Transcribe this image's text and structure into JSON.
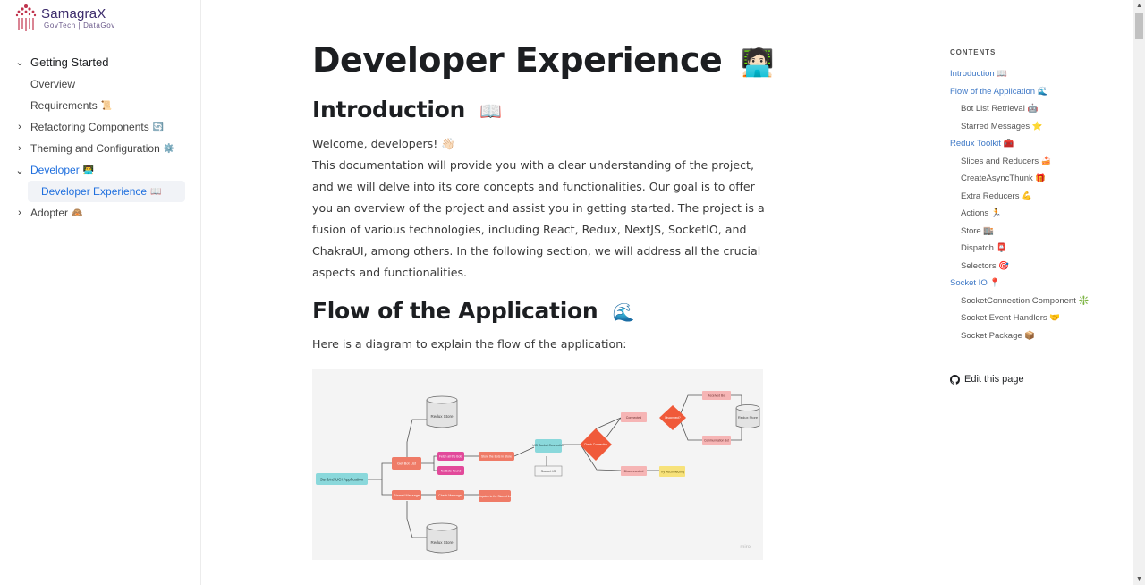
{
  "brand": {
    "name": "SamagraX",
    "tagline": "GovTech | DataGov"
  },
  "sidebar": {
    "items": [
      {
        "label": "Getting Started",
        "chevron": "down"
      },
      {
        "label": "Overview"
      },
      {
        "label": "Requirements",
        "emoji": "📜"
      },
      {
        "label": "Refactoring Components",
        "emoji": "🔄",
        "chevron": "right"
      },
      {
        "label": "Theming and Configuration",
        "emoji": "⚙️",
        "chevron": "right"
      },
      {
        "label": "Developer",
        "emoji": "👨‍💻",
        "chevron": "down"
      },
      {
        "label": "Developer Experience",
        "emoji": "📖"
      },
      {
        "label": "Adopter",
        "emoji": "🙈",
        "chevron": "right"
      }
    ]
  },
  "main": {
    "title": "Developer Experience",
    "title_emoji": "🧑🏻‍💻",
    "intro": {
      "heading": "Introduction",
      "emoji": "📖",
      "welcome": "Welcome, developers! 👋🏻",
      "body": "This documentation will provide you with a clear understanding of the project, and we will delve into its core concepts and functionalities. Our goal is to offer you an overview of the project and assist you in getting started. The project is a fusion of various technologies, including React, Redux, NextJS, SocketIO, and ChakraUI, among others. In the following section, we will address all the crucial aspects and functionalities."
    },
    "flow": {
      "heading": "Flow of the Application",
      "emoji": "🌊",
      "body": "Here is a diagram to explain the flow of the application:"
    },
    "diagram": {
      "nodes": {
        "start": "Sunbird UCI Application",
        "redux_top": "Redux Store",
        "redux_bottom": "Redux Store",
        "redux_right": "Redux Store",
        "get_bot_list": "Get Bot List",
        "fetch_bots": "Fetch all the Bots",
        "no_bots": "No Bots Found",
        "store_bots": "Store the Bots in Store",
        "socket_conn": "UCI Socket Connection",
        "socket_io": "Socket IO",
        "check_conn": "Check Connection",
        "connected": "Connected",
        "disconnected": "Disconnected",
        "try_reconnect": "Try Reconnecting",
        "is_user_connected": "Disconnect?",
        "received_bot": "Received Bot",
        "comm_bot": "Communication Bot",
        "starred": "Starred Message",
        "check_message": "Check Message",
        "dispatch_star": "Dispatch to the Starred list"
      },
      "watermark": "miro",
      "colors": {
        "salmon": "#ef7b67",
        "pink": "#e2499a",
        "teal": "#8ad8db",
        "red": "#f05a3a",
        "lightpink": "#f6b5b5",
        "yellow": "#f7e27a",
        "db": "#e3e3e3"
      }
    }
  },
  "toc": {
    "heading": "CONTENTS",
    "items": [
      {
        "label": "Introduction 📖",
        "level": 1
      },
      {
        "label": "Flow of the Application 🌊",
        "level": 1
      },
      {
        "label": "Bot List Retrieval 🤖",
        "level": 2
      },
      {
        "label": "Starred Messages ⭐",
        "level": 2
      },
      {
        "label": "Redux Toolkit 🧰",
        "level": 1
      },
      {
        "label": "Slices and Reducers 🍰",
        "level": 2
      },
      {
        "label": "CreateAsyncThunk 🎁",
        "level": 2
      },
      {
        "label": "Extra Reducers 💪",
        "level": 2
      },
      {
        "label": "Actions 🏃",
        "level": 2
      },
      {
        "label": "Store 🏬",
        "level": 2
      },
      {
        "label": "Dispatch 📮",
        "level": 2
      },
      {
        "label": "Selectors 🎯",
        "level": 2
      },
      {
        "label": "Socket IO 📍",
        "level": 1
      },
      {
        "label": "SocketConnection Component ❇️",
        "level": 2
      },
      {
        "label": "Socket Event Handlers 🤝",
        "level": 2
      },
      {
        "label": "Socket Package 📦",
        "level": 2
      }
    ],
    "edit_label": "Edit this page"
  }
}
